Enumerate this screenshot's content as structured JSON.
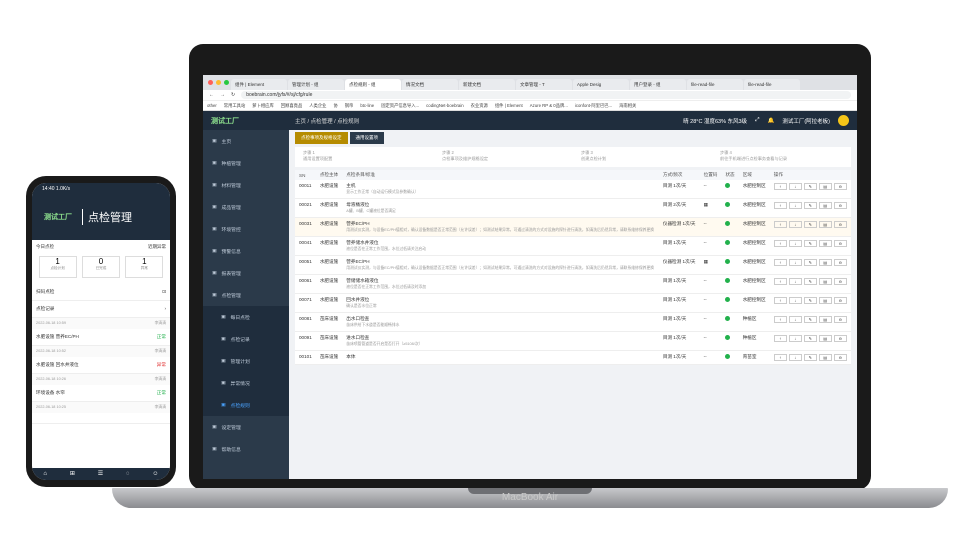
{
  "browser": {
    "tabs": [
      "组件 | Element",
      "管理计划 - 组",
      "点检规则 - 组",
      "情况文档",
      "新建文档",
      "文章管理 - T",
      "Apple Desig",
      "用户登录 - 组",
      "file-read-file",
      "file-read-file"
    ],
    "url": "boebrain.com/jyfs/#/sj/cfg/rule",
    "bookmarks": [
      "other",
      "常用工具站",
      "萝卜相应库",
      "回顾喜竟品",
      "人类企业",
      "协",
      "钢帝",
      "btc-line",
      "固定资产信息导入...",
      "codingNet-boebrain",
      "农业资源",
      "组件 | Element",
      "Azure RP & 0品牌...",
      "iconfont-阿里巴巴...",
      "海南相关"
    ]
  },
  "app": {
    "logo": "测试工厂",
    "breadcrumb": "主页 / 点检管理 / 点检规则",
    "weather": "晴 28°C 湿度63% 东风3级",
    "user": "测试工厂(阿拉老板)"
  },
  "sidebar": [
    {
      "label": "主页",
      "sub": false
    },
    {
      "label": "种植管理",
      "sub": false
    },
    {
      "label": "材料管理",
      "sub": false
    },
    {
      "label": "成品管理",
      "sub": false
    },
    {
      "label": "环境管控",
      "sub": false
    },
    {
      "label": "预警信息",
      "sub": false
    },
    {
      "label": "报表管理",
      "sub": false
    },
    {
      "label": "点检管理",
      "sub": false
    },
    {
      "label": "每日点检",
      "sub": true
    },
    {
      "label": "点检记录",
      "sub": true
    },
    {
      "label": "管理计划",
      "sub": true
    },
    {
      "label": "异常情况",
      "sub": true
    },
    {
      "label": "点检规则",
      "sub": true,
      "current": true
    },
    {
      "label": "设定管理",
      "sub": false
    },
    {
      "label": "帮助信息",
      "sub": false
    }
  ],
  "subtabs": [
    "点检事项及规格设定",
    "通用设置项"
  ],
  "steps": [
    {
      "t": "步骤 1",
      "d": "通用设置项配置"
    },
    {
      "t": "步骤 2",
      "d": "点检事项及维护规格设定"
    },
    {
      "t": "步骤 3",
      "d": "创建点检计划"
    },
    {
      "t": "步骤 4",
      "d": "前往手机端进行点检事务查看与记录"
    }
  ],
  "table": {
    "headers": [
      "SN",
      "点检主体",
      "点检条目/标准",
      "方式/频次",
      "位置码",
      "状态",
      "区域",
      "操作"
    ],
    "rows": [
      {
        "sn": "00011",
        "subject": "水肥设施",
        "item": "主机",
        "desc": "显示工作正常（自动运行模式及参数确认）",
        "freq": "目测 1次/天",
        "pos": "--",
        "area": "水肥控制区",
        "hl": false
      },
      {
        "sn": "00021",
        "subject": "水肥设施",
        "item": "母液桶液位",
        "desc": "A罐、B罐、C罐液位是否满足",
        "freq": "目测 2次/天",
        "pos": "▦",
        "area": "水肥控制区",
        "hl": false
      },
      {
        "sn": "00031",
        "subject": "水肥设施",
        "item": "营养EC/PH",
        "desc": "用测试仪实测，与设备EC/PH值相对，确认设备数据是否正常范围（允许误差）；如测试结果异常，可通过清洗的方式对设施的探针进行清洗，如清洗后仍然异常，请联系维修保养更换",
        "freq": "仪器检测 1次/天",
        "pos": "--",
        "area": "水肥控制区",
        "hl": true
      },
      {
        "sn": "00041",
        "subject": "水肥设施",
        "item": "营养储水井液位",
        "desc": "液位是否在正常工作范围，水位过低请关注启动",
        "freq": "目测 1次/天",
        "pos": "--",
        "area": "水肥控制区",
        "hl": false
      },
      {
        "sn": "00051",
        "subject": "水肥设施",
        "item": "营养EC/PH",
        "desc": "用测试仪实测，与设备EC/PH值相对，确认设备数据是否正常范围（允许误差）；如测试结果异常，可通过清洗的方式对设施的探针进行清洗，如清洗后仍然异常，请联系维修保养更换",
        "freq": "仪器检测 1次/天",
        "pos": "▦",
        "area": "水肥控制区",
        "hl": false
      },
      {
        "sn": "00061",
        "subject": "水肥设施",
        "item": "营储储水箱液位",
        "desc": "液位是否在正常工作范围，水位过低请及时添加",
        "freq": "目测 1次/天",
        "pos": "--",
        "area": "水肥控制区",
        "hl": false
      },
      {
        "sn": "00071",
        "subject": "水肥设施",
        "item": "回水井液位",
        "desc": "确认是否水位正常",
        "freq": "目测 1次/天",
        "pos": "--",
        "area": "水肥控制区",
        "hl": false
      },
      {
        "sn": "00081",
        "subject": "苗床设施",
        "item": "出水口检查",
        "desc": "苗床供给下水道是否能顺畅排水",
        "freq": "目测 1次/天",
        "pos": "--",
        "area": "种植区",
        "hl": false
      },
      {
        "sn": "00091",
        "subject": "苗床设施",
        "item": "进水口检查",
        "desc": "苗床喷管管道是否开启是否打开（≥5108/次）",
        "freq": "目测 1次/天",
        "pos": "--",
        "area": "种植区",
        "hl": false
      },
      {
        "sn": "00101",
        "subject": "苗床设施",
        "item": "本体",
        "desc": "",
        "freq": "目测 1次/天",
        "pos": "--",
        "area": "育苗室",
        "hl": false
      }
    ]
  },
  "phone": {
    "time": "14:40 1.0K/s",
    "logo": "测试工厂",
    "title": "点检管理",
    "today_label": "今日点检",
    "recent_label": "近期异常",
    "stats": [
      {
        "v": "1",
        "l": "点检计划"
      },
      {
        "v": "0",
        "l": "已完成"
      },
      {
        "v": "1",
        "l": "异常"
      }
    ],
    "scan": "扫码点检",
    "record": "点检记录",
    "entries": [
      {
        "date": "2022-06-18 10:59",
        "who": "李清清",
        "item": "水肥设施  营养EC/PH",
        "status": "正常",
        "ok": true
      },
      {
        "date": "2022-06-18 10:52",
        "who": "李清清",
        "item": "水肥设施  回水井液位",
        "status": "异常",
        "ok": false
      },
      {
        "date": "2022-06-18 10:26",
        "who": "李清清",
        "item": "环境设备  水帘",
        "status": "正常",
        "ok": true
      },
      {
        "date": "2022-06-18 10:25",
        "who": "李清清",
        "item": "",
        "status": "",
        "ok": true
      }
    ]
  },
  "brand": "MacBook Air"
}
